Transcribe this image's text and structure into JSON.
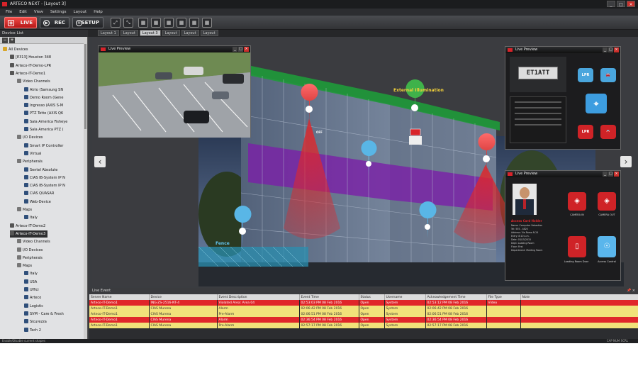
{
  "window": {
    "title": "ARTECO NEXT - [Layout 3]",
    "min_label": "_",
    "max_label": "□",
    "close_label": "×"
  },
  "menu": [
    "File",
    "Edit",
    "View",
    "Settings",
    "Layout",
    "Help"
  ],
  "toolbar": {
    "live_label": "LIVE",
    "rec_label": "REC",
    "setup_label": "SETUP"
  },
  "layout_icons": [
    "⤢",
    "⤡",
    "▦",
    "▦",
    "▦",
    "▦",
    "▦",
    "▦"
  ],
  "device_list": {
    "title": "Device List",
    "nodes": [
      "All Devices",
      "[E313] Houston 348",
      "Arteco-IT-Demo-LPR",
      "Arteco-IT-Demo1",
      "Video Channels",
      "Atrio (Samsung SN",
      "Demo Room (Gene",
      "Ingresso (AXIS S-M",
      "PTZ Tetto (AXIS Q6",
      "Sala America Fisheye",
      "Sala America PTZ (",
      "I/O Devices",
      "Smart IP Controller",
      "Virtual",
      "Peripherals",
      "Sentel Absolute",
      "CIAS IB-System IP N",
      "CIAS IB-System IP N",
      "CIAS QUASAR",
      "Web-Device",
      "Maps",
      "Italy",
      "Arteco-IT-Demo2",
      "Arteco-IT-Demo3",
      "Video Channels",
      "I/O Devices",
      "Peripherals",
      "Maps",
      "Italy",
      "USA",
      "Uffici",
      "Arteco",
      "Logistic",
      "SVM - Care & Fresh",
      "Sicurezza",
      "Tech 2"
    ]
  },
  "layout_tabs": [
    "Layout 1",
    "Layout",
    "Layout 3",
    "Layout",
    "Layout",
    "Layout"
  ],
  "map_labels": {
    "external": "External Illumination",
    "fence": "Fence",
    "off_badge": "OFF"
  },
  "previews": {
    "title": "Live Preview",
    "lpr_label": "LPR",
    "plate": "ET1ATT",
    "person_name": "Access Card Holder",
    "cam_labels": [
      "CAMERA IN",
      "CAMERA OUT"
    ],
    "door_labels": [
      "Loading Room Door",
      "Access Control"
    ],
    "info_lines": [
      "Name: Computer Sebastian",
      "Tel: 555 - 4820",
      "Address: Via Roma N.24",
      "Entry: 8:10 a.m.",
      "Date: 03/15/2015",
      "Dept: Loading Room",
      "Floor: First",
      "Department: Meeting Room"
    ]
  },
  "live_event": {
    "title": "Live Event",
    "columns": [
      "Server Name",
      "Device",
      "Event Description",
      "Event Time",
      "Status",
      "Username",
      "Acknowledgement Time",
      "File Type",
      "Note"
    ],
    "rows": [
      [
        "Arteco-IT-Demo1",
        "ING-ZS-2516-NT-4",
        "Violated Area: Area 04",
        "02:53:03 PM 08 Feb 2016",
        "Open",
        "System",
        "02:53:12 PM 08 Feb 2016",
        "Video",
        ""
      ],
      [
        "Arteco-IT-Demo1",
        "CIAS Murena",
        "Alarm",
        "02:06:42 PM 08 Feb 2016",
        "Open",
        "System",
        "02:06:42 PM 08 Feb 2016",
        "",
        ""
      ],
      [
        "Arteco-IT-Demo1",
        "CIAS Murena",
        "Pre-Alarm",
        "02:06:51 PM 08 Feb 2016",
        "Open",
        "System",
        "02:06:51 PM 08 Feb 2016",
        "",
        ""
      ],
      [
        "Arteco-IT-Demo1",
        "CIAS Murena",
        "Alarm",
        "02:36:54 PM 08 Feb 2016",
        "Open",
        "System",
        "02:36:54 PM 08 Feb 2016",
        "",
        ""
      ],
      [
        "Arteco-IT-Demo1",
        "CIAS Murena",
        "Pre-Alarm",
        "02:57:17 PM 08 Feb 2016",
        "Open",
        "System",
        "02:57:17 PM 08 Feb 2016",
        "",
        ""
      ]
    ],
    "row_styles": [
      "red",
      "yellow",
      "yellow",
      "red",
      "yellow"
    ]
  },
  "statusbar": {
    "left": "Enable/Disable current shapes",
    "right": "CAP  NUM  SCRL"
  },
  "colors": {
    "accent_red": "#d8232a",
    "alarm_row": "#e0262a",
    "prealarm_row": "#f1e27a",
    "zone_purple": "#7a1fa8",
    "zone_green": "#1f9a3a"
  }
}
